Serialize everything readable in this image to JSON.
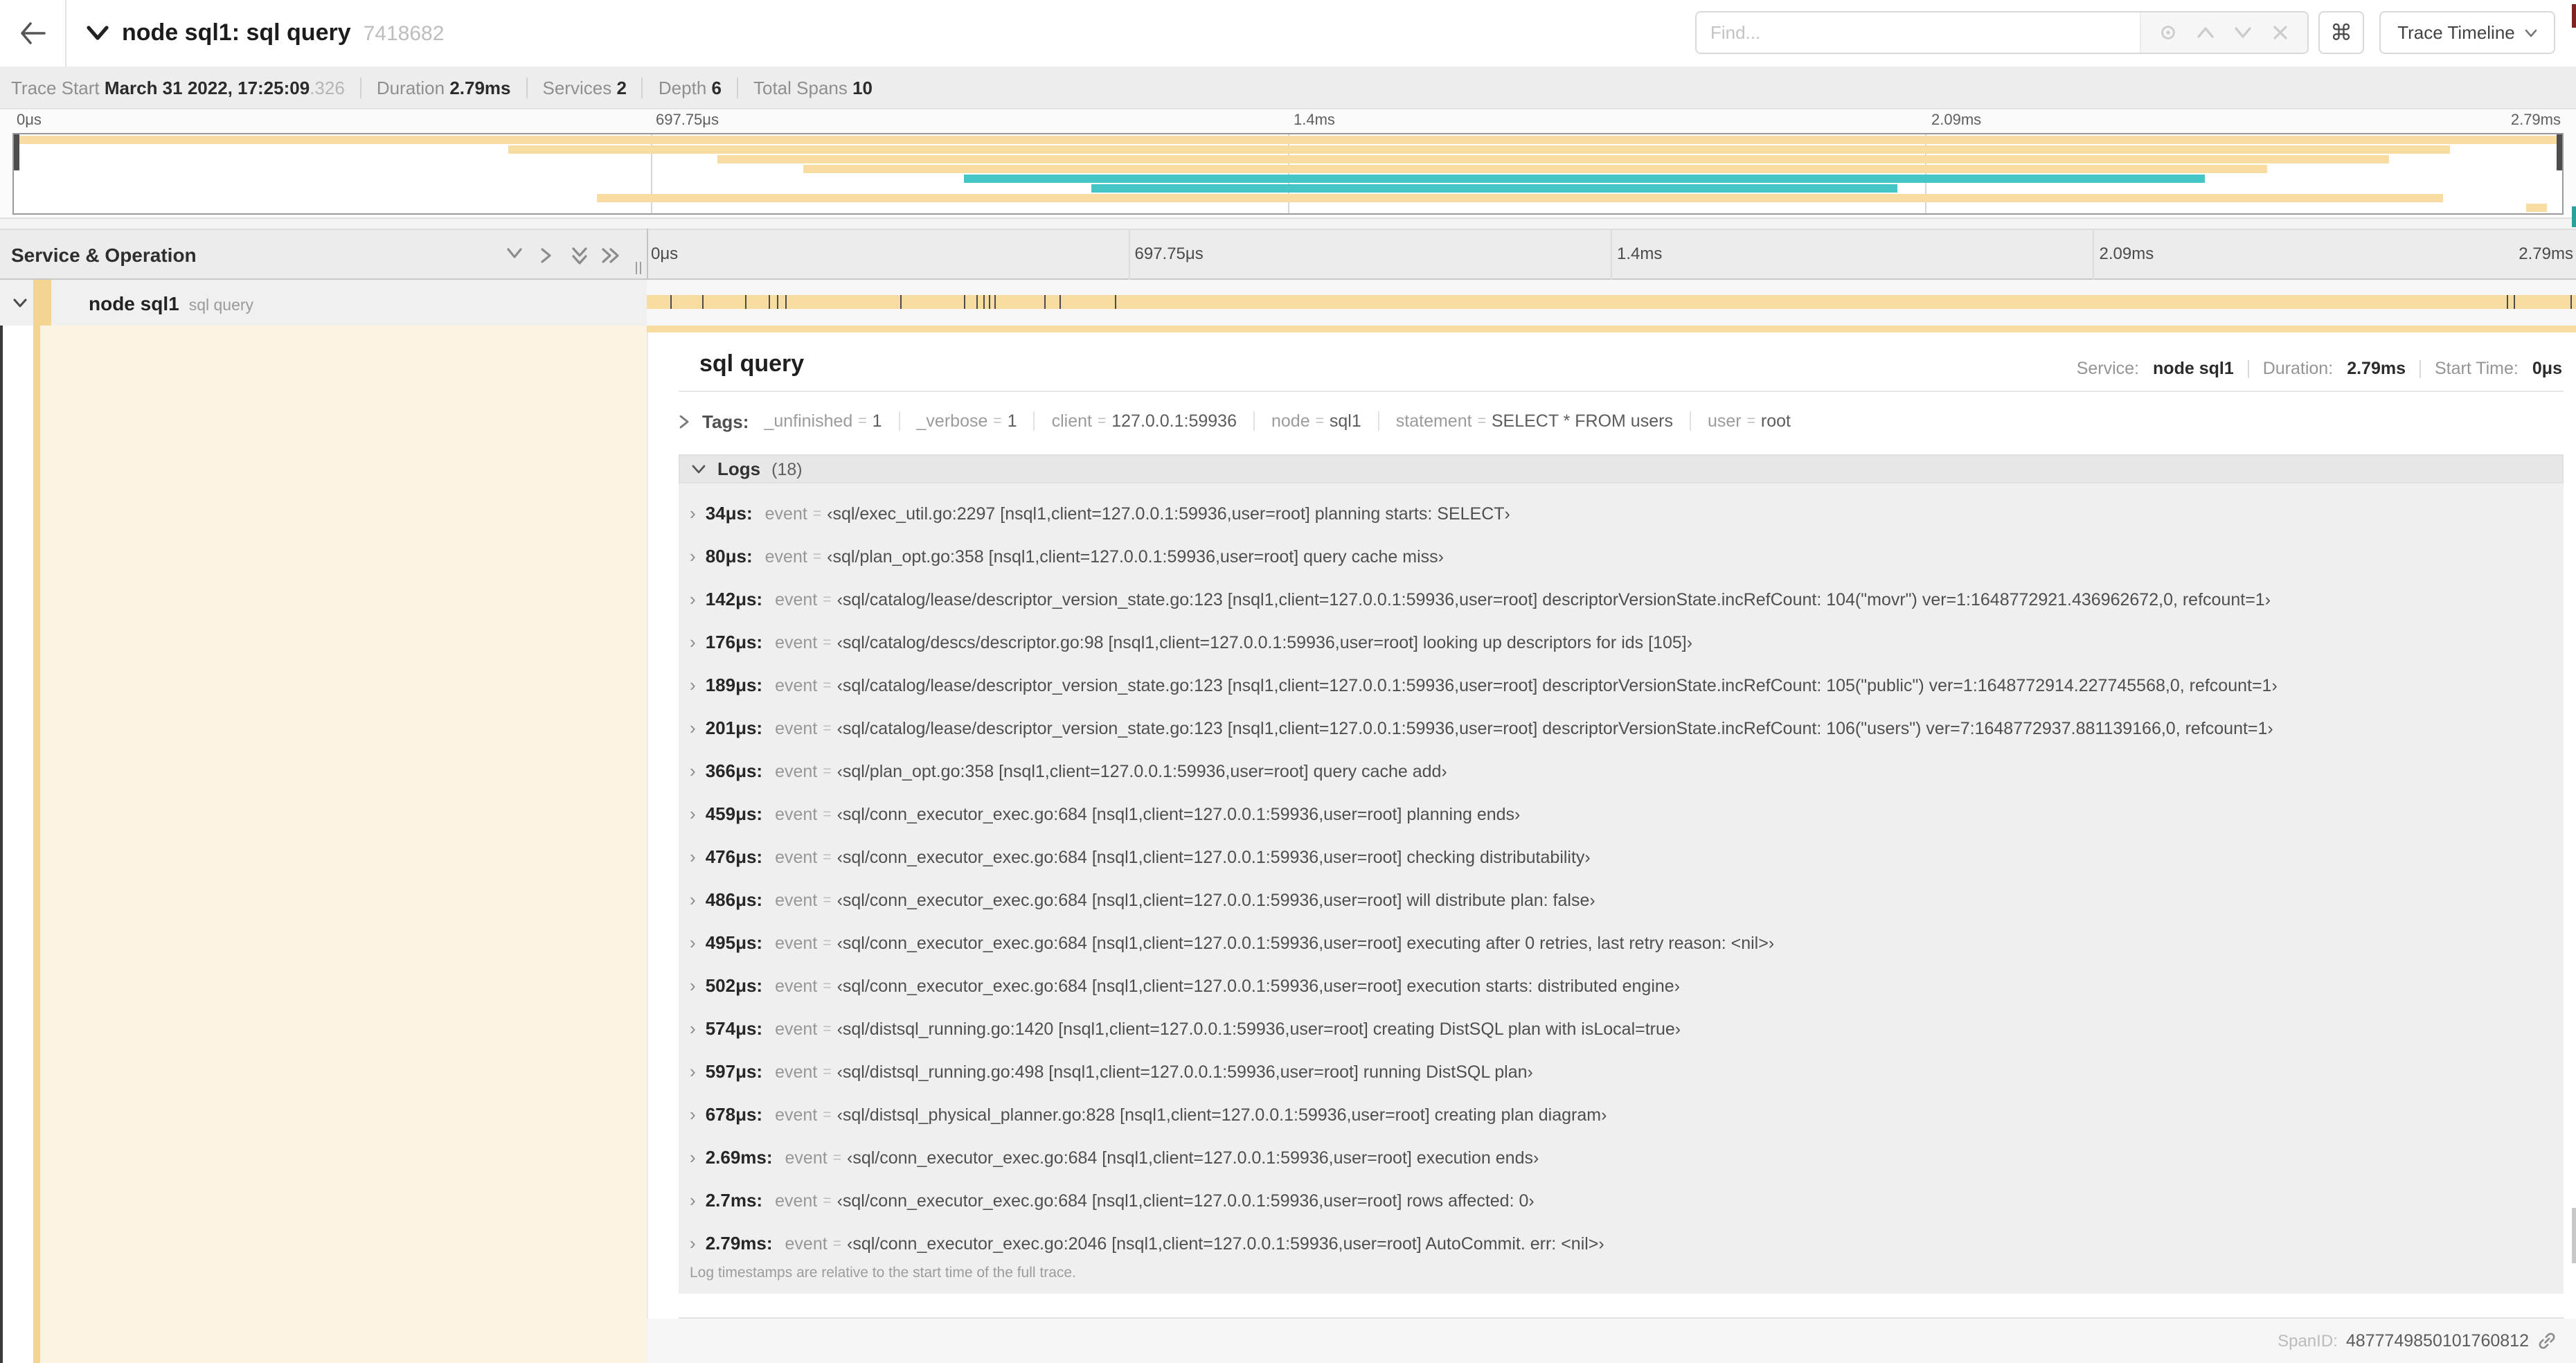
{
  "colors": {
    "span_tan": "#F8DCA1",
    "span_teal": "#45C5C5",
    "accent_tan": "#F3D491",
    "cream": "#FCF3E2",
    "scrub_handle": "#4D4D4D"
  },
  "header": {
    "title": "node sql1: sql query",
    "trace_id": "7418682",
    "find_placeholder": "Find...",
    "shortcut_glyph": "⌘",
    "view_dropdown_label": "Trace Timeline"
  },
  "metadata": {
    "items": [
      {
        "label": "Trace Start",
        "value": "March 31 2022, 17:25:09",
        "suffix": ".326"
      },
      {
        "label": "Duration",
        "value": "2.79ms"
      },
      {
        "label": "Services",
        "value": "2"
      },
      {
        "label": "Depth",
        "value": "6"
      },
      {
        "label": "Total Spans",
        "value": "10"
      }
    ]
  },
  "axis": {
    "ticks": [
      {
        "label": "0μs",
        "pct": 0
      },
      {
        "label": "697.75μs",
        "pct": 25
      },
      {
        "label": "1.4ms",
        "pct": 50
      },
      {
        "label": "2.09ms",
        "pct": 75
      },
      {
        "label": "2.79ms",
        "pct": 100
      }
    ]
  },
  "minimap": {
    "spans": [
      {
        "row": 0,
        "start": 0,
        "end": 100,
        "color": "tan"
      },
      {
        "row": 1,
        "start": 19.4,
        "end": 95.6,
        "color": "tan"
      },
      {
        "row": 2,
        "start": 27.6,
        "end": 93.2,
        "color": "tan"
      },
      {
        "row": 3,
        "start": 31.0,
        "end": 88.4,
        "color": "tan"
      },
      {
        "row": 4,
        "start": 37.3,
        "end": 86.0,
        "color": "teal"
      },
      {
        "row": 5,
        "start": 42.3,
        "end": 73.9,
        "color": "teal"
      },
      {
        "row": 6,
        "start": 22.9,
        "end": 95.3,
        "color": "tan"
      },
      {
        "row": 7,
        "start": 98.6,
        "end": 99.4,
        "color": "tan"
      }
    ]
  },
  "timeline": {
    "column_header": "Service & Operation",
    "row": {
      "service": "node sql1",
      "operation": "sql query",
      "marker_pcts": [
        1.22,
        2.87,
        5.09,
        6.31,
        6.77,
        7.2,
        13.12,
        16.45,
        17.06,
        17.42,
        17.74,
        17.99,
        20.57,
        21.4,
        24.3,
        96.42,
        96.77,
        99.7
      ]
    }
  },
  "detail": {
    "title": "sql query",
    "summary": [
      {
        "label": "Service:",
        "value": "node sql1"
      },
      {
        "label": "Duration:",
        "value": "2.79ms"
      },
      {
        "label": "Start Time:",
        "value": "0μs"
      }
    ],
    "tags_label": "Tags:",
    "tags": [
      {
        "key": "_unfinished",
        "value": "1"
      },
      {
        "key": "_verbose",
        "value": "1"
      },
      {
        "key": "client",
        "value": "127.0.0.1:59936"
      },
      {
        "key": "node",
        "value": "sql1"
      },
      {
        "key": "statement",
        "value": "SELECT * FROM users"
      },
      {
        "key": "user",
        "value": "root"
      }
    ],
    "logs_label": "Logs",
    "logs_count": "(18)",
    "log_field": "event",
    "logs": [
      {
        "time": "34μs:",
        "value": "‹sql/exec_util.go:2297 [nsql1,client=127.0.0.1:59936,user=root] planning starts: SELECT›"
      },
      {
        "time": "80μs:",
        "value": "‹sql/plan_opt.go:358 [nsql1,client=127.0.0.1:59936,user=root] query cache miss›"
      },
      {
        "time": "142μs:",
        "value": "‹sql/catalog/lease/descriptor_version_state.go:123 [nsql1,client=127.0.0.1:59936,user=root] descriptorVersionState.incRefCount: 104(\"movr\") ver=1:1648772921.436962672,0, refcount=1›"
      },
      {
        "time": "176μs:",
        "value": "‹sql/catalog/descs/descriptor.go:98 [nsql1,client=127.0.0.1:59936,user=root] looking up descriptors for ids [105]›"
      },
      {
        "time": "189μs:",
        "value": "‹sql/catalog/lease/descriptor_version_state.go:123 [nsql1,client=127.0.0.1:59936,user=root] descriptorVersionState.incRefCount: 105(\"public\") ver=1:1648772914.227745568,0, refcount=1›"
      },
      {
        "time": "201μs:",
        "value": "‹sql/catalog/lease/descriptor_version_state.go:123 [nsql1,client=127.0.0.1:59936,user=root] descriptorVersionState.incRefCount: 106(\"users\") ver=7:1648772937.881139166,0, refcount=1›"
      },
      {
        "time": "366μs:",
        "value": "‹sql/plan_opt.go:358 [nsql1,client=127.0.0.1:59936,user=root] query cache add›"
      },
      {
        "time": "459μs:",
        "value": "‹sql/conn_executor_exec.go:684 [nsql1,client=127.0.0.1:59936,user=root] planning ends›"
      },
      {
        "time": "476μs:",
        "value": "‹sql/conn_executor_exec.go:684 [nsql1,client=127.0.0.1:59936,user=root] checking distributability›"
      },
      {
        "time": "486μs:",
        "value": "‹sql/conn_executor_exec.go:684 [nsql1,client=127.0.0.1:59936,user=root] will distribute plan: false›"
      },
      {
        "time": "495μs:",
        "value": "‹sql/conn_executor_exec.go:684 [nsql1,client=127.0.0.1:59936,user=root] executing after 0 retries, last retry reason: <nil>›"
      },
      {
        "time": "502μs:",
        "value": "‹sql/conn_executor_exec.go:684 [nsql1,client=127.0.0.1:59936,user=root] execution starts: distributed engine›"
      },
      {
        "time": "574μs:",
        "value": "‹sql/distsql_running.go:1420 [nsql1,client=127.0.0.1:59936,user=root] creating DistSQL plan with isLocal=true›"
      },
      {
        "time": "597μs:",
        "value": "‹sql/distsql_running.go:498 [nsql1,client=127.0.0.1:59936,user=root] running DistSQL plan›"
      },
      {
        "time": "678μs:",
        "value": "‹sql/distsql_physical_planner.go:828 [nsql1,client=127.0.0.1:59936,user=root] creating plan diagram›"
      },
      {
        "time": "2.69ms:",
        "value": "‹sql/conn_executor_exec.go:684 [nsql1,client=127.0.0.1:59936,user=root] execution ends›"
      },
      {
        "time": "2.7ms:",
        "value": "‹sql/conn_executor_exec.go:684 [nsql1,client=127.0.0.1:59936,user=root] rows affected: 0›"
      },
      {
        "time": "2.79ms:",
        "value": "‹sql/conn_executor_exec.go:2046 [nsql1,client=127.0.0.1:59936,user=root] AutoCommit. err: <nil>›"
      }
    ],
    "footnote": "Log timestamps are relative to the start time of the full trace.",
    "span_id_label": "SpanID:",
    "span_id": "4877749850101760812"
  }
}
